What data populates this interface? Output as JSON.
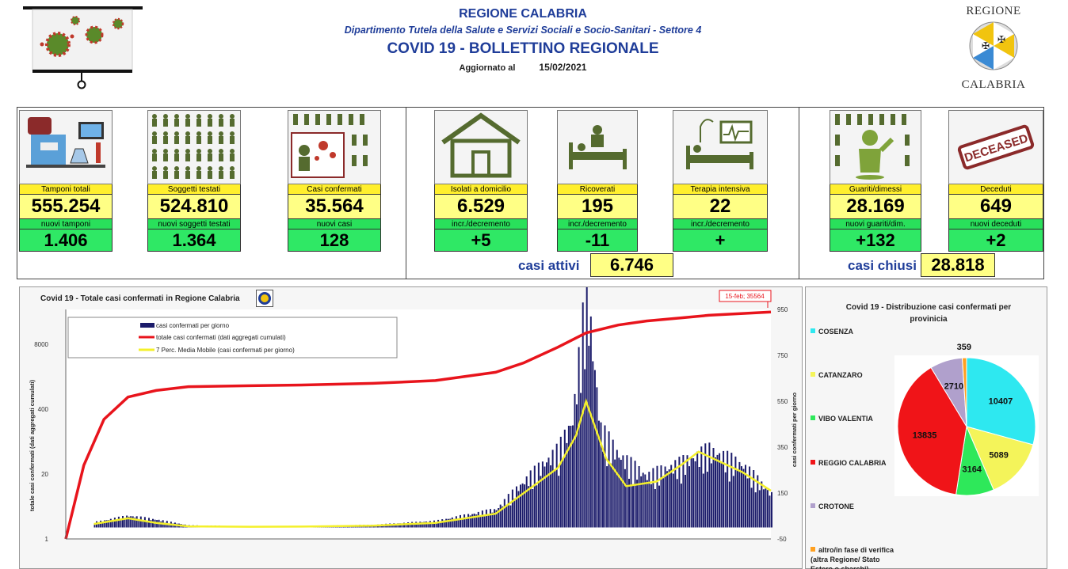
{
  "header": {
    "region": "REGIONE CALABRIA",
    "department": "Dipartimento Tutela della Salute e Servizi Sociali e Socio-Sanitari - Settore 4",
    "title": "COVID 19 - BOLLETTINO REGIONALE",
    "updated_label": "Aggiornato al",
    "updated_date": "15/02/2021",
    "logo_top": "REGIONE",
    "logo_bottom": "CALABRIA"
  },
  "kpis": [
    {
      "label": "Tamponi totali",
      "value": "555.254",
      "sub_label": "nuovi tamponi",
      "sub_value": "1.406",
      "icon": "lab-test-icon"
    },
    {
      "label": "Soggetti testati",
      "value": "524.810",
      "sub_label": "nuovi soggetti testati",
      "sub_value": "1.364",
      "icon": "people-grid-icon"
    },
    {
      "label": "Casi confermati",
      "value": "35.564",
      "sub_label": "nuovi casi",
      "sub_value": "128",
      "icon": "virus-person-icon"
    },
    {
      "label": "Isolati a domicilio",
      "value": "6.529",
      "sub_label": "incr./decremento",
      "sub_value": "+5",
      "icon": "house-icon"
    },
    {
      "label": "Ricoverati",
      "value": "195",
      "sub_label": "incr./decremento",
      "sub_value": "-11",
      "icon": "hospital-bed-icon"
    },
    {
      "label": "Terapia intensiva",
      "value": "22",
      "sub_label": "incr./decremento",
      "sub_value": "+",
      "icon": "icu-monitor-icon"
    },
    {
      "label": "Guariti/dimessi",
      "value": "28.169",
      "sub_label": "nuovi guariti/dim.",
      "sub_value": "+132",
      "icon": "recovered-person-icon"
    },
    {
      "label": "Deceduti",
      "value": "649",
      "sub_label": "nuovi deceduti",
      "sub_value": "+2",
      "icon": "deceased-stamp-icon",
      "stamp_text": "DECEASED"
    }
  ],
  "summary": {
    "active_label": "casi attivi",
    "active_value": "6.746",
    "closed_label": "casi chiusi",
    "closed_value": "28.818"
  },
  "colors": {
    "title_blue": "#1f3d99",
    "kpi_yellow": "#ffff85",
    "kpi_green": "#2fe865",
    "bar_navy": "#1c1c6b",
    "line_red": "#e8141c",
    "line_yellow": "#f4f02a",
    "cosenza": "#2ee8f0",
    "catanzaro": "#f4f45a",
    "vibo": "#2ee85a",
    "reggio": "#f01418",
    "crotone": "#b0a0cc",
    "altro": "#ffa020"
  },
  "chart_data": [
    {
      "type": "bar",
      "title": "Covid 19 - Totale casi confermati in Regione Calabria",
      "ylabel": "totale casi confermati (dati aggregati cumulati)",
      "y2label": "casi confermati per giorno",
      "y_log_ticks": [
        "8000",
        "400",
        "20",
        "1"
      ],
      "y2_ticks": [
        950,
        750,
        550,
        350,
        150,
        -50
      ],
      "y2lim": [
        -50,
        950
      ],
      "x_range": [
        "2020-03-01",
        "2021-02-15"
      ],
      "annotation": "15-feb; 35564",
      "legend": [
        "casi confermati per giorno",
        "totale casi confermati (dati aggregati cumulati)",
        "7 Perc. Media Mobile (casi confermati per giorno)"
      ],
      "series": [
        {
          "name": "totale casi confermati (dati aggregati cumulati)",
          "type": "line",
          "x": [
            "2020-03-01",
            "2020-03-10",
            "2020-03-20",
            "2020-04-01",
            "2020-04-15",
            "2020-05-01",
            "2020-06-01",
            "2020-07-01",
            "2020-08-01",
            "2020-09-01",
            "2020-10-01",
            "2020-10-15",
            "2020-11-01",
            "2020-11-15",
            "2020-12-01",
            "2020-12-15",
            "2021-01-01",
            "2021-01-15",
            "2021-02-01",
            "2021-02-15"
          ],
          "values": [
            1,
            30,
            250,
            700,
            950,
            1130,
            1180,
            1230,
            1320,
            1500,
            2200,
            3400,
            7000,
            13500,
            19500,
            23500,
            27000,
            30500,
            33200,
            35564
          ]
        },
        {
          "name": "casi confermati per giorno",
          "type": "bar",
          "x": [
            "2020-03-15",
            "2020-04-01",
            "2020-04-15",
            "2020-05-01",
            "2020-06-01",
            "2020-07-01",
            "2020-08-01",
            "2020-09-01",
            "2020-10-01",
            "2020-10-15",
            "2020-11-01",
            "2020-11-08",
            "2020-11-15",
            "2020-11-22",
            "2020-12-01",
            "2020-12-15",
            "2021-01-01",
            "2021-01-15",
            "2021-02-01",
            "2021-02-15"
          ],
          "values": [
            20,
            45,
            30,
            8,
            4,
            6,
            10,
            25,
            70,
            180,
            300,
            420,
            930,
            380,
            280,
            200,
            250,
            300,
            240,
            128
          ]
        },
        {
          "name": "7 Perc. Media Mobile (casi confermati per giorno)",
          "type": "line",
          "x": [
            "2020-03-15",
            "2020-04-01",
            "2020-04-15",
            "2020-05-01",
            "2020-06-01",
            "2020-07-01",
            "2020-08-01",
            "2020-09-01",
            "2020-10-01",
            "2020-10-15",
            "2020-11-01",
            "2020-11-10",
            "2020-11-15",
            "2020-11-25",
            "2020-12-05",
            "2020-12-20",
            "2021-01-01",
            "2021-01-10",
            "2021-02-01",
            "2021-02-15"
          ],
          "values": [
            15,
            40,
            20,
            5,
            3,
            4,
            8,
            20,
            60,
            150,
            260,
            400,
            550,
            300,
            180,
            200,
            270,
            330,
            240,
            160
          ]
        }
      ]
    },
    {
      "type": "pie",
      "title": "Covid 19 - Distribuzione casi confermati per provinicia",
      "categories": [
        "COSENZA",
        "CATANZARO",
        "VIBO VALENTIA",
        "REGGIO CALABRIA",
        "CROTONE",
        "altro/in fase di verifica (altra Regione/ Stato Estero o sbarchi)"
      ],
      "values": [
        10407,
        5089,
        3164,
        13835,
        2710,
        359
      ]
    }
  ]
}
